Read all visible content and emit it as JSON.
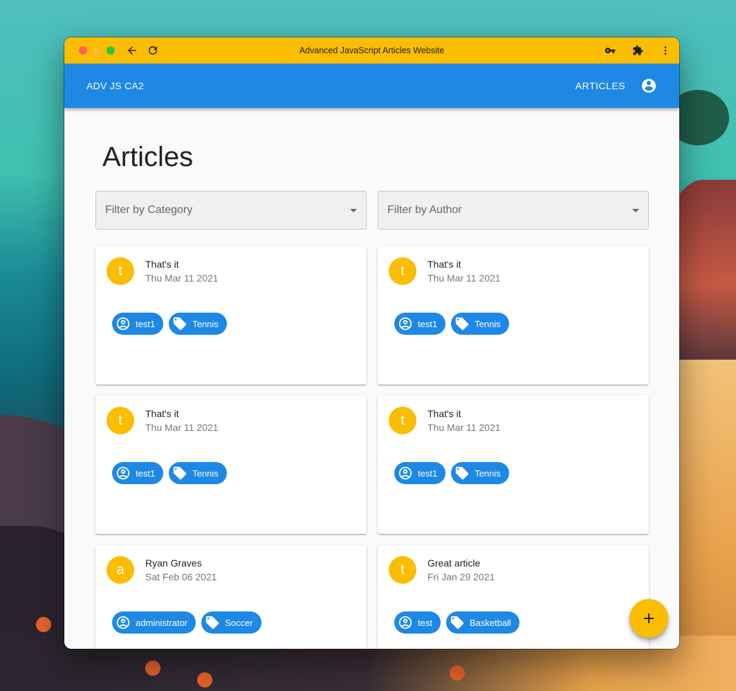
{
  "window": {
    "title": "Advanced JavaScript Articles Website"
  },
  "appbar": {
    "brand": "ADV JS CA2",
    "nav_articles": "ARTICLES"
  },
  "page": {
    "title": "Articles"
  },
  "filters": {
    "category_placeholder": "Filter by Category",
    "author_placeholder": "Filter by Author"
  },
  "articles": [
    {
      "avatar": "t",
      "title": "That's it",
      "date": "Thu Mar 11 2021",
      "author": "test1",
      "category": "Tennis"
    },
    {
      "avatar": "t",
      "title": "That's it",
      "date": "Thu Mar 11 2021",
      "author": "test1",
      "category": "Tennis"
    },
    {
      "avatar": "t",
      "title": "That's it",
      "date": "Thu Mar 11 2021",
      "author": "test1",
      "category": "Tennis"
    },
    {
      "avatar": "t",
      "title": "That's it",
      "date": "Thu Mar 11 2021",
      "author": "test1",
      "category": "Tennis"
    },
    {
      "avatar": "a",
      "title": "Ryan Graves",
      "date": "Sat Feb 06 2021",
      "author": "administrator",
      "category": "Soccer"
    },
    {
      "avatar": "t",
      "title": "Great article",
      "date": "Fri Jan 29 2021",
      "author": "test",
      "category": "Basketball"
    }
  ],
  "fab": {
    "label": "+"
  },
  "colors": {
    "titlebar": "#fbbd00",
    "appbar": "#1e88e5",
    "avatar": "#fbbd00",
    "chip": "#1e88e5",
    "fab": "#fbbd00"
  },
  "icons": {
    "back": "arrow-back-icon",
    "reload": "reload-icon",
    "key": "key-icon",
    "extensions": "puzzle-icon",
    "menu": "more-vert-icon",
    "account": "account-circle-icon",
    "author_chip": "account-circle-outline-icon",
    "category_chip": "tag-icon",
    "fab": "add-icon"
  }
}
